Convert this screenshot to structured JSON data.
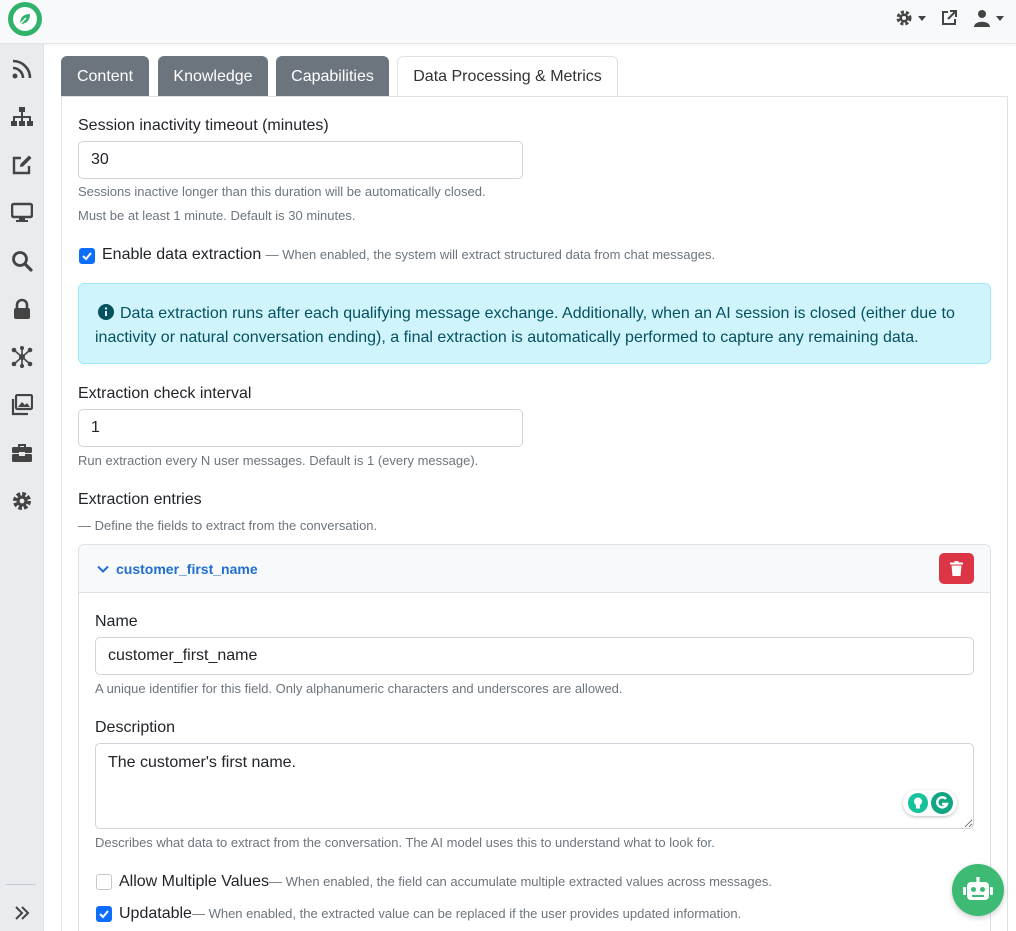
{
  "icons": {
    "logo": "leaf-logo-icon",
    "settings": "gear-icon",
    "external": "external-link-icon",
    "user": "user-icon",
    "sidebar": [
      "rss-icon",
      "sitemap-icon",
      "edit-icon",
      "monitor-icon",
      "search-icon",
      "lock-icon",
      "network-icon",
      "images-icon",
      "toolbox-icon",
      "gear-icon",
      "double-chevron-right-icon"
    ],
    "info": "info-circle-icon",
    "chevron": "chevron-down-icon",
    "trash": "trash-icon",
    "bot": "robot-icon"
  },
  "colors": {
    "brand_green": "#2fb36b",
    "primary": "#0d6efd",
    "danger": "#dc3545",
    "tab_inactive": "#6c757d",
    "info_bg": "#cff4fc",
    "link_blue": "#1f6fd1"
  },
  "tabs": [
    {
      "label": "Content"
    },
    {
      "label": "Knowledge"
    },
    {
      "label": "Capabilities"
    },
    {
      "label": "Data Processing & Metrics"
    }
  ],
  "session_timeout": {
    "label": "Session inactivity timeout (minutes)",
    "value": "30",
    "help1": "Sessions inactive longer than this duration will be automatically closed.",
    "help2": "Must be at least 1 minute. Default is 30 minutes."
  },
  "data_extraction": {
    "label": "Enable data extraction",
    "hint": "— When enabled, the system will extract structured data from chat messages.",
    "checked": true
  },
  "info_alert": {
    "text": "Data extraction runs after each qualifying message exchange. Additionally, when an AI session is closed (either due to inactivity or natural conversation ending), a final extraction is automatically performed to capture any remaining data."
  },
  "check_interval": {
    "label": "Extraction check interval",
    "value": "1",
    "help": "Run extraction every N user messages. Default is 1 (every message)."
  },
  "entries": {
    "label": "Extraction entries",
    "hint": "— Define the fields to extract from the conversation."
  },
  "entry": {
    "title": "customer_first_name",
    "name_label": "Name",
    "name_value": "customer_first_name",
    "name_help": "A unique identifier for this field. Only alphanumeric characters and underscores are allowed.",
    "desc_label": "Description",
    "desc_value": "The customer's first name.",
    "desc_help": "Describes what data to extract from the conversation. The AI model uses this to understand what to look for.",
    "allow_multiple_label": "Allow Multiple Values",
    "allow_multiple_hint": "— When enabled, the field can accumulate multiple extracted values across messages.",
    "allow_multiple_checked": false,
    "updatable_label": "Updatable",
    "updatable_hint": "— When enabled, the extracted value can be replaced if the user provides updated information.",
    "updatable_checked": true
  }
}
